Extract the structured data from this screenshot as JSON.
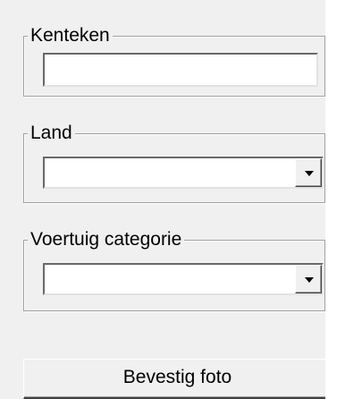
{
  "plate_group": {
    "legend": "Kenteken",
    "value": ""
  },
  "country_group": {
    "legend": "Land",
    "selected": ""
  },
  "category_group": {
    "legend": "Voertuig categorie",
    "selected": ""
  },
  "confirm_button": {
    "label": "Bevestig foto"
  },
  "icons": {
    "dropdown": "chevron-down-icon"
  }
}
